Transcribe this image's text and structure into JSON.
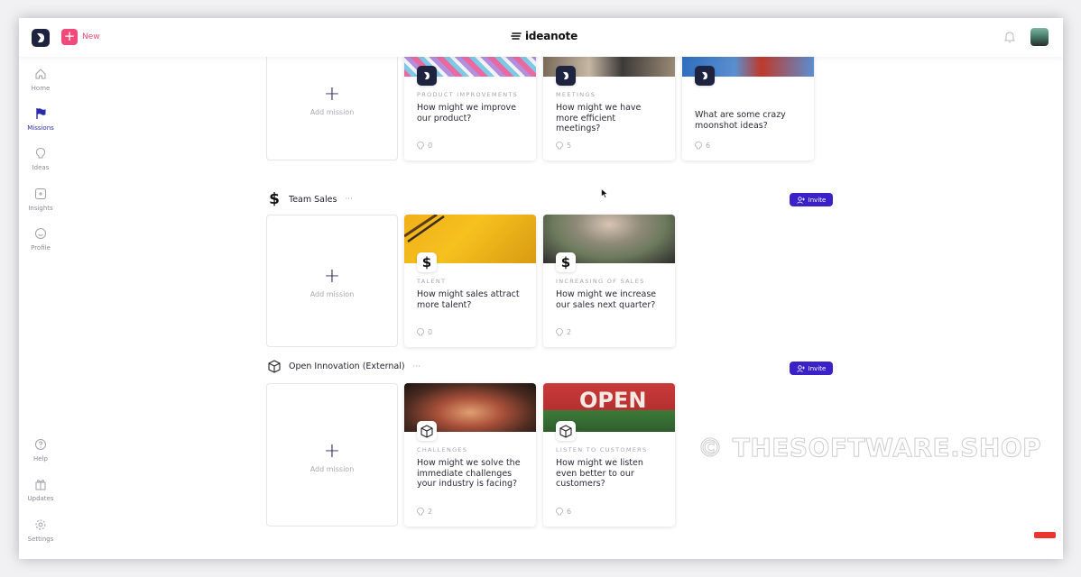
{
  "topbar": {
    "new_label": "New",
    "brand": "ideanote",
    "logo_icon": "ideanote-logo-icon",
    "bell_icon": "bell-icon"
  },
  "sidebar": {
    "top": [
      {
        "label": "Home",
        "icon": "home-icon",
        "active": false
      },
      {
        "label": "Missions",
        "icon": "flag-icon",
        "active": true
      },
      {
        "label": "Ideas",
        "icon": "lightbulb-icon",
        "active": false
      },
      {
        "label": "Insights",
        "icon": "insights-icon",
        "active": false
      },
      {
        "label": "Profile",
        "icon": "smiley-icon",
        "active": false
      }
    ],
    "bottom": [
      {
        "label": "Help",
        "icon": "help-icon"
      },
      {
        "label": "Updates",
        "icon": "gift-icon"
      },
      {
        "label": "Settings",
        "icon": "gear-icon"
      }
    ]
  },
  "add_mission_label": "Add mission",
  "invite_label": "Invite",
  "groups": [
    {
      "name": "",
      "cards": [
        {
          "category": "PRODUCT IMPROVEMENTS",
          "title": "How might we improve our product?",
          "count": "0"
        },
        {
          "category": "MEETINGS",
          "title": "How might we have more efficient meetings?",
          "count": "5"
        },
        {
          "category": "",
          "title": "What are some crazy moonshot ideas?",
          "count": "6"
        }
      ]
    },
    {
      "name": "Team Sales",
      "icon": "dollar-icon",
      "cards": [
        {
          "category": "TALENT",
          "title": "How might sales attract more talent?",
          "count": "0"
        },
        {
          "category": "INCREASING OF SALES",
          "title": "How might we increase our sales next quarter?",
          "count": "2"
        }
      ]
    },
    {
      "name": "Open Innovation (External)",
      "icon": "cube-icon",
      "cards": [
        {
          "category": "CHALLENGES",
          "title": "How might we solve the immediate challenges your industry is facing?",
          "count": "2"
        },
        {
          "category": "LISTEN TO CUSTOMERS",
          "title": "How might we listen even better to our customers?",
          "count": "6"
        }
      ]
    }
  ],
  "colors": {
    "accent": "#3a22c8",
    "new_pink": "#f04a7a",
    "nav_active": "#2b2ba8"
  },
  "watermark": "© THESOFTWARE.SHOP"
}
